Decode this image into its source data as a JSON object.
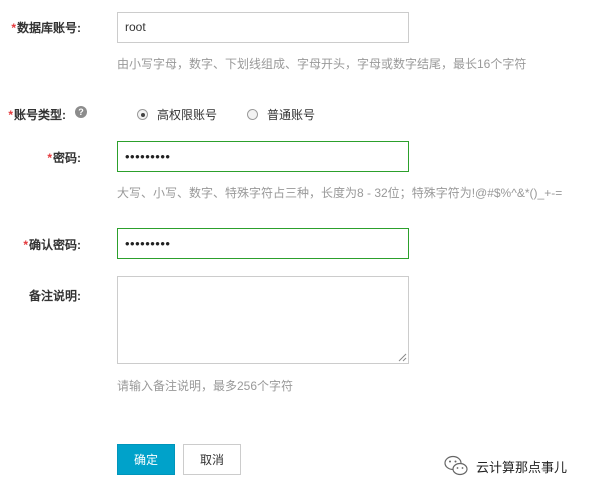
{
  "form": {
    "db_account": {
      "required_mark": "*",
      "label": "数据库账号:",
      "value": "root",
      "hint": "由小写字母，数字、下划线组成、字母开头，字母或数字结尾，最长16个字符"
    },
    "account_type": {
      "required_mark": "*",
      "label": "账号类型:",
      "help_icon": "?",
      "options": [
        {
          "label": "高权限账号",
          "checked": true
        },
        {
          "label": "普通账号",
          "checked": false
        }
      ]
    },
    "password": {
      "required_mark": "*",
      "label": "密码:",
      "value": "•••••••••",
      "hint": "大写、小写、数字、特殊字符占三种，长度为8 - 32位；特殊字符为!@#$%^&*()_+-="
    },
    "confirm_password": {
      "required_mark": "*",
      "label": "确认密码:",
      "value": "•••••••••"
    },
    "remark": {
      "label": "备注说明:",
      "value": "",
      "hint": "请输入备注说明，最多256个字符"
    }
  },
  "buttons": {
    "confirm_label": "确定",
    "cancel_label": "取消"
  },
  "watermark": {
    "text": "云计算那点事儿",
    "icon": "wechat-icon"
  },
  "colors": {
    "required": "#e4393c",
    "primary_button": "#00a2ca",
    "valid_border": "#2ca02c",
    "hint_text": "#999999"
  }
}
